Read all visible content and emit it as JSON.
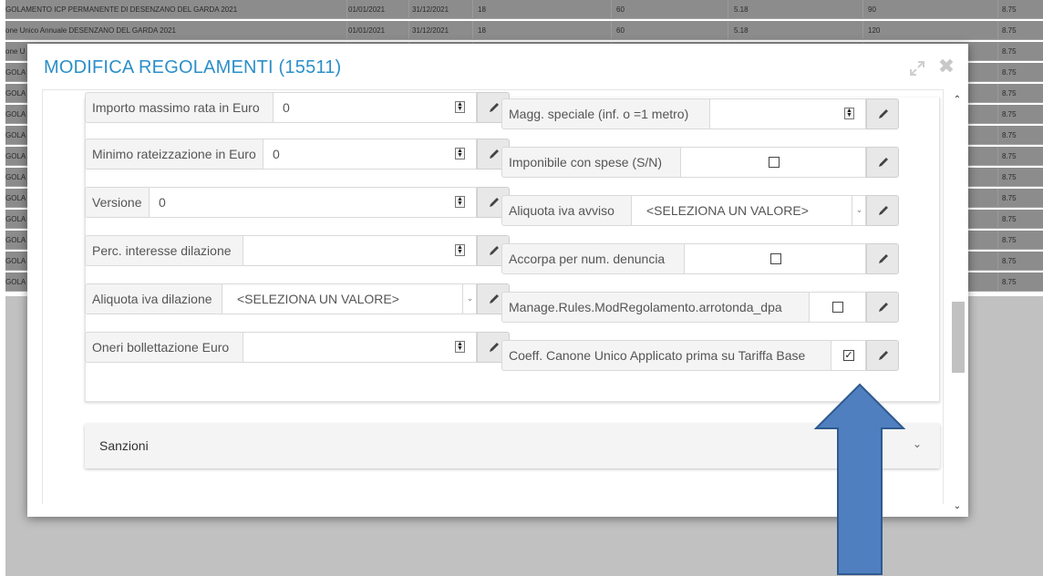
{
  "background_table": {
    "rows": [
      {
        "name": "GOLAMENTO ICP PERMANENTE DI DESENZANO DEL GARDA 2021",
        "start": "01/01/2021",
        "end": "31/12/2021",
        "n": "18",
        "c60": "60",
        "c518": "5.18",
        "dur": "90",
        "c875": "8.75"
      },
      {
        "name": "one Unico Annuale DESENZANO DEL GARDA 2021",
        "start": "01/01/2021",
        "end": "31/12/2021",
        "n": "18",
        "c60": "60",
        "c518": "5.18",
        "dur": "120",
        "c875": "8.75"
      },
      {
        "name": "one U",
        "start": "",
        "end": "",
        "n": "",
        "c60": "",
        "c518": "",
        "dur": "",
        "c875": "8.75"
      },
      {
        "name": "GOLA",
        "start": "",
        "end": "",
        "n": "",
        "c60": "",
        "c518": "",
        "dur": "",
        "c875": "8.75"
      },
      {
        "name": "GOLA",
        "start": "",
        "end": "",
        "n": "",
        "c60": "",
        "c518": "",
        "dur": "",
        "c875": "8.75"
      },
      {
        "name": "GOLA",
        "start": "",
        "end": "",
        "n": "",
        "c60": "",
        "c518": "",
        "dur": "",
        "c875": "8.75"
      },
      {
        "name": "GOLA",
        "start": "",
        "end": "",
        "n": "",
        "c60": "",
        "c518": "",
        "dur": "",
        "c875": "8.75"
      },
      {
        "name": "GOLA",
        "start": "",
        "end": "",
        "n": "",
        "c60": "",
        "c518": "",
        "dur": "",
        "c875": "8.75"
      },
      {
        "name": "GOLA",
        "start": "",
        "end": "",
        "n": "",
        "c60": "",
        "c518": "",
        "dur": "",
        "c875": "8.75"
      },
      {
        "name": "GOLA",
        "start": "",
        "end": "",
        "n": "",
        "c60": "",
        "c518": "",
        "dur": "",
        "c875": "8.75"
      },
      {
        "name": "GOLA",
        "start": "",
        "end": "",
        "n": "",
        "c60": "",
        "c518": "",
        "dur": "",
        "c875": "8.75"
      },
      {
        "name": "GOLA",
        "start": "",
        "end": "",
        "n": "",
        "c60": "",
        "c518": "",
        "dur": "",
        "c875": "8.75"
      },
      {
        "name": "GOLA",
        "start": "",
        "end": "",
        "n": "",
        "c60": "",
        "c518": "",
        "dur": "",
        "c875": "8.75"
      },
      {
        "name": "GOLA",
        "start": "",
        "end": "",
        "n": "",
        "c60": "",
        "c518": "",
        "dur": "",
        "c875": "8.75"
      }
    ]
  },
  "modal": {
    "title": "MODIFICA REGOLAMENTI (15511)",
    "icons": {
      "expand": "expand-icon",
      "close": "close-icon"
    },
    "left_fields": [
      {
        "label": "Importo massimo rata in Euro",
        "value": "0",
        "kind": "number"
      },
      {
        "label": "Minimo rateizzazione in Euro",
        "value": "0",
        "kind": "number"
      },
      {
        "label": "Versione",
        "value": "0",
        "kind": "number"
      },
      {
        "label": "Perc. interesse dilazione",
        "value": "",
        "kind": "number"
      },
      {
        "label": "Aliquota iva dilazione",
        "value": "<SELEZIONA UN VALORE>",
        "kind": "select"
      },
      {
        "label": "Oneri bollettazione Euro",
        "value": "",
        "kind": "number"
      }
    ],
    "right_fields": [
      {
        "label": "Magg. speciale (inf. o =1 metro)",
        "value": "",
        "kind": "number"
      },
      {
        "label": "Imponibile con spese (S/N)",
        "checked": false,
        "kind": "checkbox"
      },
      {
        "label": "Aliquota iva avviso",
        "value": "<SELEZIONA UN VALORE>",
        "kind": "select"
      },
      {
        "label": "Accorpa per num. denuncia",
        "checked": false,
        "kind": "checkbox"
      },
      {
        "label": "Manage.Rules.ModRegolamento.arrotonda_dpa",
        "checked": false,
        "kind": "checkbox"
      },
      {
        "label": "Coeff. Canone Unico Applicato prima su Tariffa Base",
        "checked": true,
        "kind": "checkbox"
      }
    ],
    "sections": {
      "sanzioni": "Sanzioni"
    }
  },
  "annotation": {
    "arrow_color": "#4f7fbf",
    "arrow_outline": "#2f5a8f"
  },
  "colors": {
    "title": "#2b8fc9"
  }
}
